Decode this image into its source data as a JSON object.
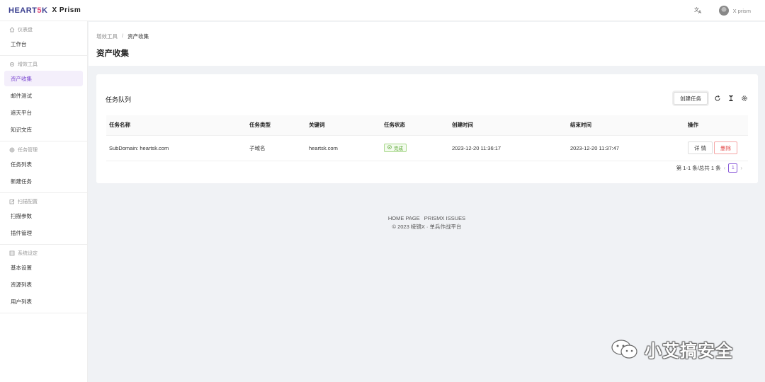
{
  "app": {
    "logo_brand_pre": "HEART",
    "logo_brand_accent": "5",
    "logo_brand_post": "K",
    "product": "X Prism",
    "user_name": "X prism"
  },
  "sidebar": {
    "groups": [
      {
        "title": "仪表盘",
        "icon": "home-icon",
        "items": [
          {
            "label": "工作台"
          }
        ]
      },
      {
        "title": "增效工具",
        "icon": "tools-icon",
        "items": [
          {
            "label": "资产收集",
            "active": true
          },
          {
            "label": "邮件测试"
          },
          {
            "label": "遮天平台"
          },
          {
            "label": "知识文库"
          }
        ]
      },
      {
        "title": "任务管理",
        "icon": "task-icon",
        "items": [
          {
            "label": "任务列表"
          },
          {
            "label": "新建任务"
          }
        ]
      },
      {
        "title": "扫描配置",
        "icon": "edit-icon",
        "items": [
          {
            "label": "扫描参数"
          },
          {
            "label": "插件管理"
          }
        ]
      },
      {
        "title": "系统设定",
        "icon": "settings-icon",
        "items": [
          {
            "label": "基本设置"
          },
          {
            "label": "资源列表"
          },
          {
            "label": "用户列表"
          }
        ]
      }
    ]
  },
  "breadcrumb": {
    "parent": "增效工具",
    "separator": "/",
    "current": "资产收集"
  },
  "page_title": "资产收集",
  "card": {
    "title": "任务队列",
    "create_button": "创建任务"
  },
  "table": {
    "columns": [
      "任务名称",
      "任务类型",
      "关键词",
      "任务状态",
      "创建时间",
      "结束时间",
      "操作"
    ],
    "rows": [
      {
        "name": "SubDomain: heartsk.com",
        "type": "子域名",
        "keyword": "heartsk.com",
        "status": "完成",
        "created": "2023-12-20 11:36:17",
        "ended": "2023-12-20 11:37:47",
        "detail": "详 情",
        "delete": "删除"
      }
    ]
  },
  "pagination": {
    "summary": "第 1-1 条/总共 1 条",
    "current_page": "1"
  },
  "footer": {
    "link1": "HOME PAGE",
    "link2": "PRISMX ISSUES",
    "copyright": "© 2023 棱镜X · 单兵作战平台"
  },
  "watermark": {
    "text": "小艾搞安全"
  },
  "colors": {
    "accent": "#7a45d0",
    "success": "#52a32a",
    "danger": "#e34a4a"
  }
}
